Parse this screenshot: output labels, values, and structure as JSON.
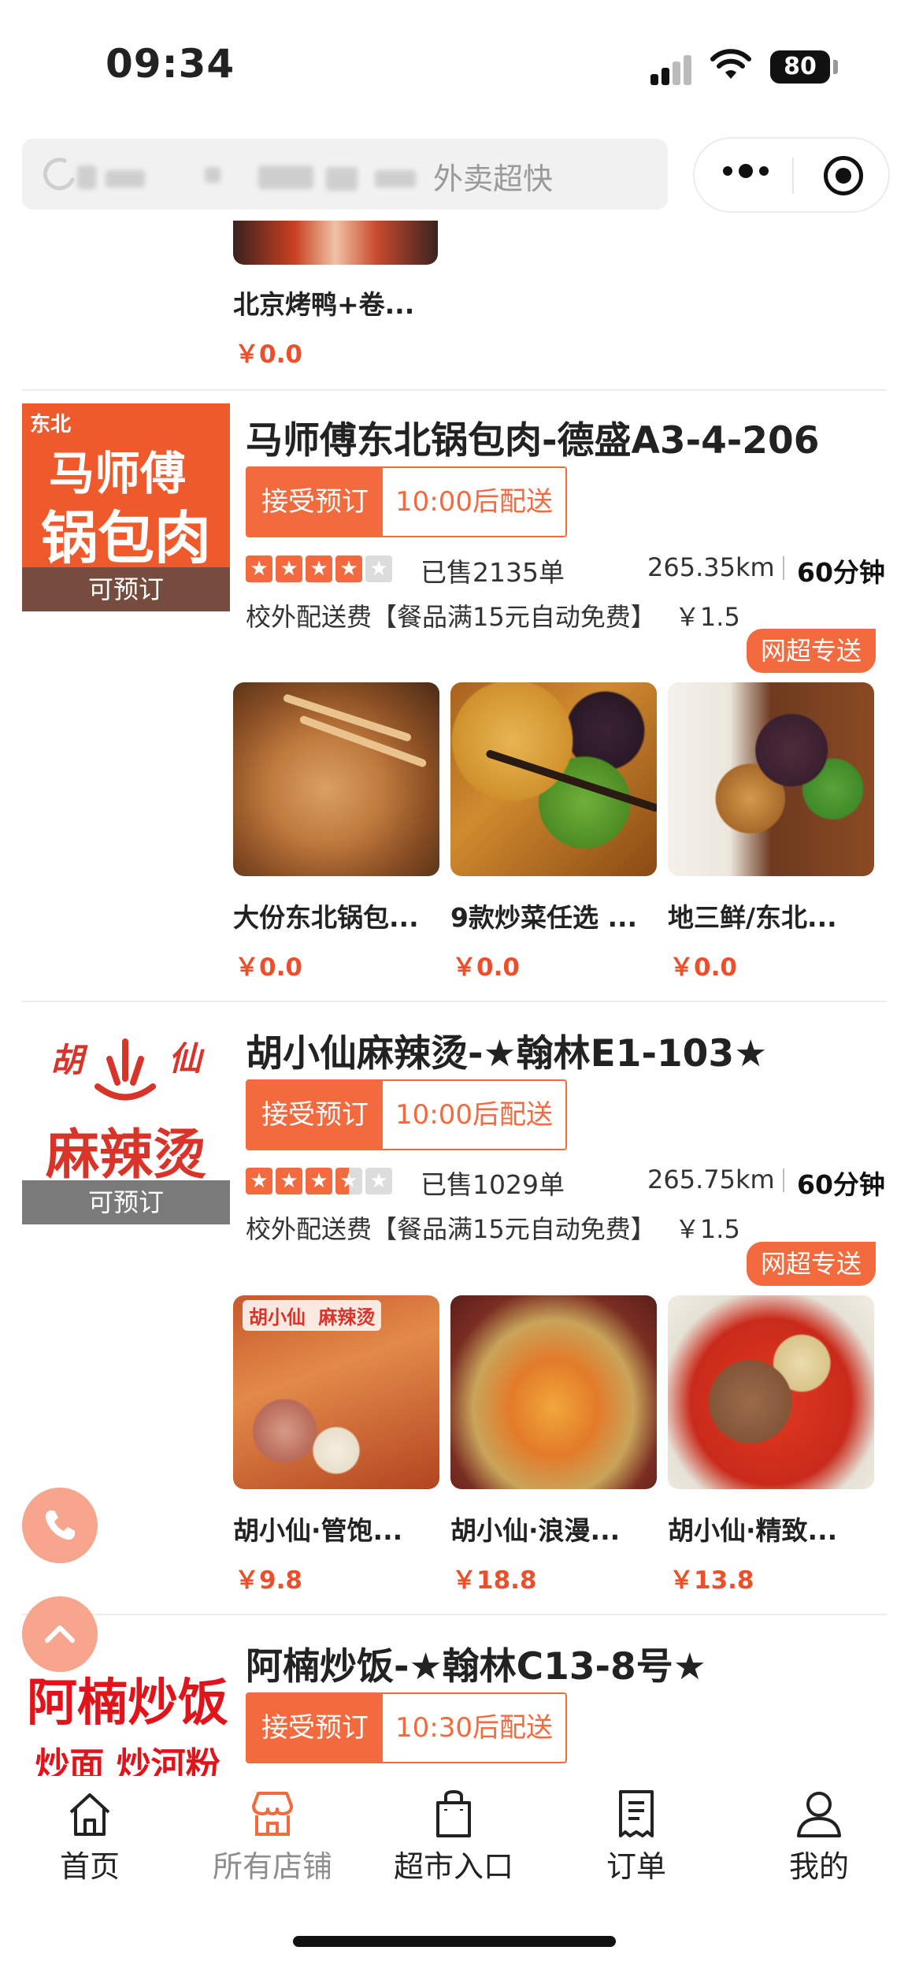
{
  "status_bar": {
    "time": "09:34",
    "battery": "80"
  },
  "header": {
    "search_text": "外卖超快",
    "icons": [
      "back-arrow-icon",
      "more-dots-icon",
      "target-icon"
    ]
  },
  "partial_item": {
    "name": "北京烤鸭+卷...",
    "price": "￥0.0"
  },
  "shops": [
    {
      "logo_lines": [
        "东北",
        "马师傅",
        "锅包肉"
      ],
      "logo_badge": "可预订",
      "name": "马师傅东北锅包肉-德盛A3-4-206",
      "tag_accept": "接受预订",
      "tag_time": "10:00后配送",
      "rating": 4,
      "sold": "已售2135单",
      "distance": "265.35km",
      "delivery_time": "60分钟",
      "fee_text": "校外配送费【餐品满15元自动免费】",
      "fee_amount": "￥1.5",
      "express_label": "网超专送",
      "items": [
        {
          "name": "大份东北锅包...",
          "price": "￥0.0"
        },
        {
          "name": "9款炒菜任选 ...",
          "price": "￥0.0"
        },
        {
          "name": "地三鲜/东北...",
          "price": "￥0.0"
        }
      ]
    },
    {
      "logo_lines": [
        "胡",
        "仙",
        "麻辣烫"
      ],
      "logo_badge": "可预订",
      "name": "胡小仙麻辣烫-★翰林E1-103★",
      "tag_accept": "接受预订",
      "tag_time": "10:00后配送",
      "rating": 3.5,
      "sold": "已售1029单",
      "distance": "265.75km",
      "delivery_time": "60分钟",
      "fee_text": "校外配送费【餐品满15元自动免费】",
      "fee_amount": "￥1.5",
      "express_label": "网超专送",
      "items": [
        {
          "name": "胡小仙·管饱...",
          "price": "￥9.8",
          "image_text": [
            "胡小仙",
            "麻辣烫"
          ]
        },
        {
          "name": "胡小仙·浪漫...",
          "price": "￥18.8"
        },
        {
          "name": "胡小仙·精致...",
          "price": "￥13.8"
        }
      ]
    },
    {
      "logo_lines": [
        "阿楠炒饭",
        "炒面 炒河粉"
      ],
      "name": "阿楠炒饭-★翰林C13-8号★",
      "tag_accept": "接受预订",
      "tag_time": "10:30后配送"
    }
  ],
  "bottom_nav": [
    {
      "label": "首页",
      "icon": "home-icon"
    },
    {
      "label": "所有店铺",
      "icon": "store-icon",
      "active": true
    },
    {
      "label": "超市入口",
      "icon": "shopping-bag-icon"
    },
    {
      "label": "订单",
      "icon": "receipt-icon"
    },
    {
      "label": "我的",
      "icon": "user-icon"
    }
  ],
  "floating": [
    "phone-icon",
    "scroll-top-icon"
  ],
  "colors": {
    "accent": "#f26a3d",
    "price": "#ef4e2a",
    "float": "#f8a58e",
    "nav_active": "#8e8e8e"
  }
}
